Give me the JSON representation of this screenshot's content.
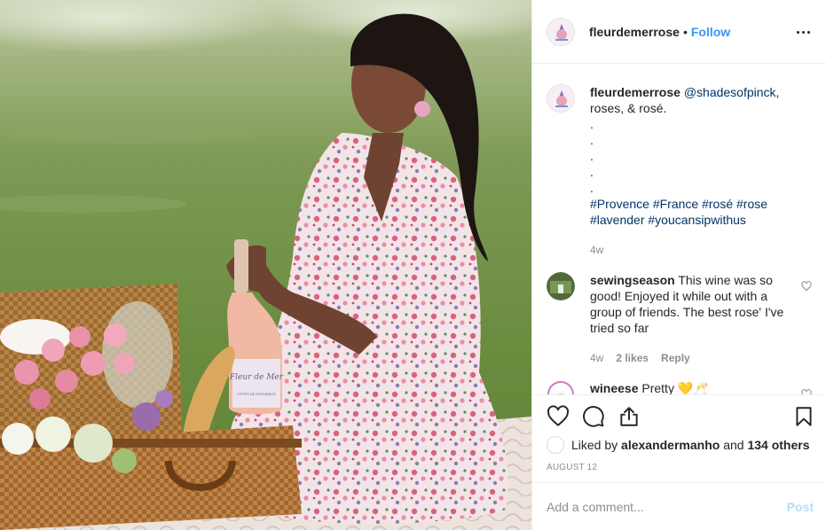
{
  "photo": {
    "description_icon": "photo",
    "bottle_label": "Fleur de Mer",
    "bottle_sub": "CÔTES DE PROVENCE"
  },
  "header": {
    "username": "fleurdemerrose",
    "separator": "•",
    "follow_label": "Follow",
    "more_icon": "more-horizontal-icon"
  },
  "caption": {
    "username": "fleurdemerrose",
    "mention": "@shadesofpinck",
    "text_after_mention": ",",
    "line2": "roses, & rosé.",
    "dots": [
      ".",
      ".",
      ".",
      ".",
      "."
    ],
    "tags_line1": [
      "#Provence",
      "#France",
      "#rosé",
      "#rose"
    ],
    "tags_line2": [
      "#lavender",
      "#youcansipwithus"
    ],
    "age": "4w"
  },
  "comments": [
    {
      "username": "sewingseason",
      "text": "This wine was so good! Enjoyed it while out with a group of friends. The best rose' I've tried so far",
      "age": "4w",
      "likes": "2 likes",
      "reply": "Reply"
    },
    {
      "username": "wineese",
      "text": "Pretty 💛🥂"
    }
  ],
  "actions": {
    "like_icon": "heart-icon",
    "comment_icon": "comment-icon",
    "share_icon": "share-icon",
    "save_icon": "bookmark-icon"
  },
  "likes": {
    "prefix": "Liked by",
    "user": "alexandermanho",
    "connector": "and",
    "others": "134 others"
  },
  "date": "AUGUST 12",
  "add_comment": {
    "placeholder": "Add a comment...",
    "post_label": "Post"
  },
  "colors": {
    "link": "#003569",
    "follow": "#3897f0",
    "post_disabled": "#b2dffc",
    "muted": "#8e8e8e"
  }
}
